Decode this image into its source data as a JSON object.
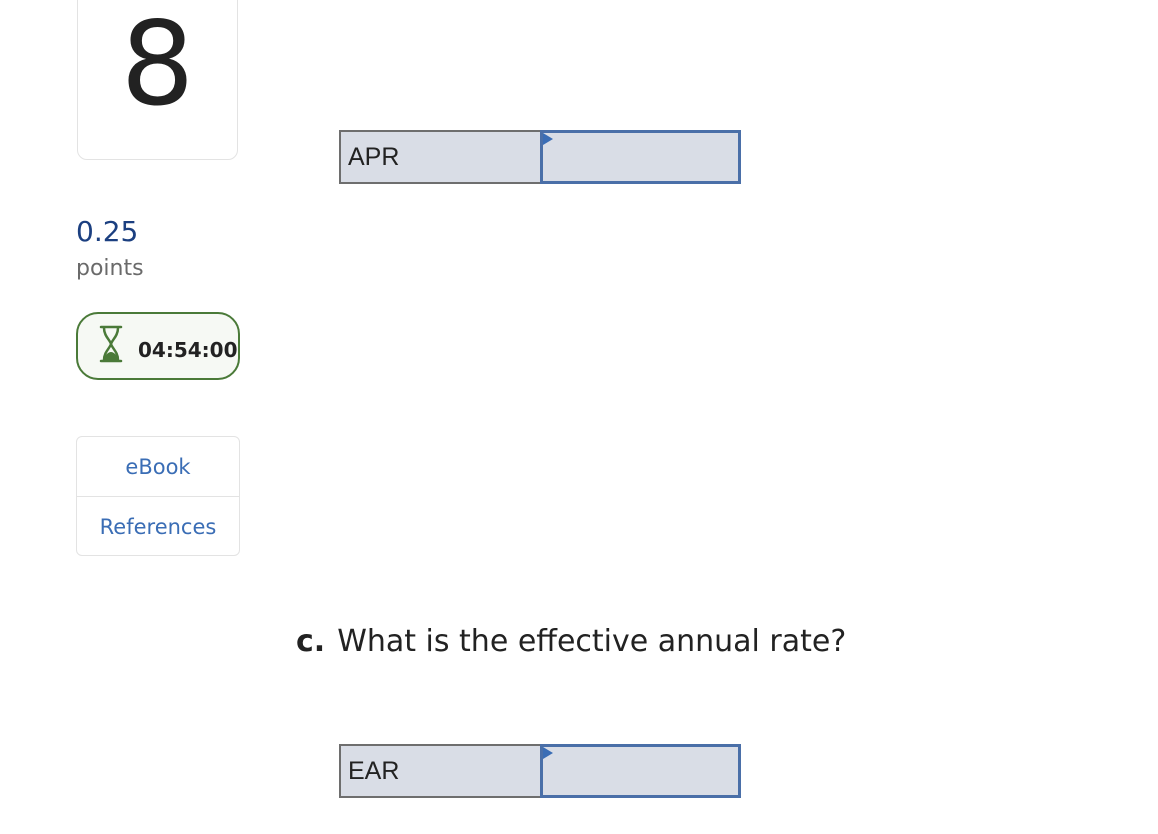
{
  "question_number": "8",
  "points": {
    "value": "0.25",
    "label": "points"
  },
  "timer": {
    "icon": "hourglass-icon",
    "time": "04:54:00",
    "color": "#4a7a38"
  },
  "resources": [
    {
      "label": "eBook"
    },
    {
      "label": "References"
    }
  ],
  "answers": [
    {
      "label": "APR",
      "value": ""
    },
    {
      "label": "EAR",
      "value": ""
    }
  ],
  "question_c": {
    "letter": "c.",
    "text": "What is the effective annual rate?"
  },
  "colors": {
    "accent": "#3a6db5",
    "points": "#1b3f80",
    "input_bg": "#d9dde6",
    "input_border": "#4a6fa8"
  }
}
